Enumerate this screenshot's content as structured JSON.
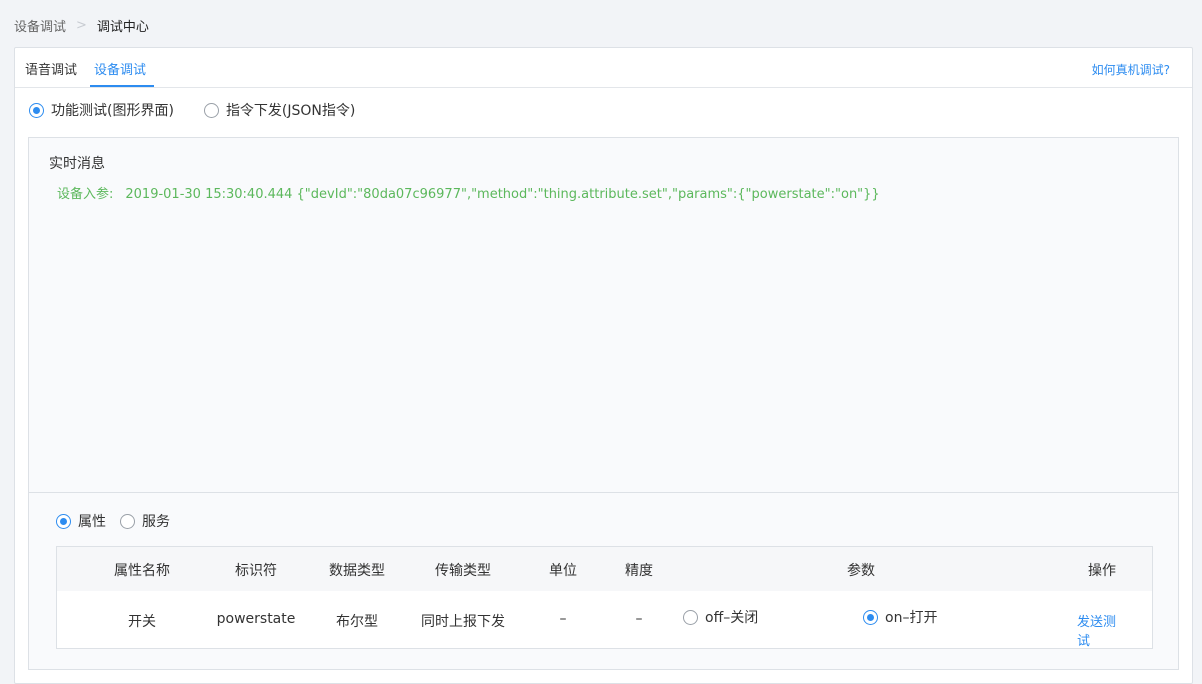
{
  "breadcrumb": {
    "parent": "设备调试",
    "separator": ">",
    "current": "调试中心"
  },
  "tabs": [
    {
      "label": "语音调试",
      "active": false
    },
    {
      "label": "设备调试",
      "active": true
    }
  ],
  "help_link": "如何真机调试?",
  "mode_options": [
    {
      "label": "功能测试(图形界面)",
      "selected": true
    },
    {
      "label": "指令下发(JSON指令)",
      "selected": false
    }
  ],
  "realtime": {
    "title": "实时消息",
    "messages": [
      {
        "label": "设备入参:",
        "text": "2019-01-30 15:30:40.444 {\"devId\":\"80da07c96977\",\"method\":\"thing.attribute.set\",\"params\":{\"powerstate\":\"on\"}}"
      }
    ]
  },
  "type_options": [
    {
      "label": "属性",
      "selected": true
    },
    {
      "label": "服务",
      "selected": false
    }
  ],
  "table": {
    "headers": [
      "属性名称",
      "标识符",
      "数据类型",
      "传输类型",
      "单位",
      "精度",
      "参数",
      "操作"
    ],
    "rows": [
      {
        "name": "开关",
        "identifier": "powerstate",
        "data_type": "布尔型",
        "transfer_type": "同时上报下发",
        "unit": "–",
        "precision": "–",
        "params": [
          {
            "label": "off–关闭",
            "selected": false
          },
          {
            "label": "on–打开",
            "selected": true
          }
        ],
        "action": "发送测试"
      }
    ]
  },
  "colors": {
    "accent": "#2d8cf0",
    "message": "#5cb85c"
  }
}
